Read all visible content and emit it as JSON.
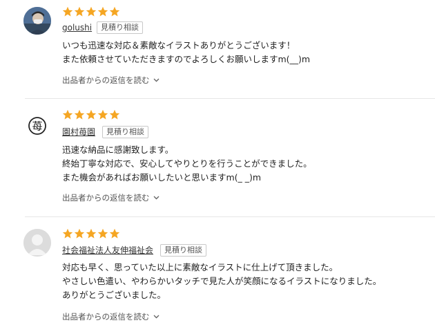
{
  "colors": {
    "star": "#f5a623",
    "divider": "#e6e6e6",
    "text": "#222222"
  },
  "reviews": [
    {
      "rating": 5,
      "avatar": "photo-avatar",
      "reviewer": "golushi",
      "tag": "見積り相談",
      "lines": [
        "いつも迅速な対応＆素敵なイラストありがとうございます！",
        "また依頼させていただきますのでよろしくお願いしますm(__)m"
      ],
      "reply_toggle": "出品者からの返信を読む"
    },
    {
      "rating": 5,
      "avatar": "kanji-avatar",
      "avatar_text": "苺",
      "reviewer": "園村苺園",
      "tag": "見積り相談",
      "lines": [
        "迅速な納品に感謝致します。",
        "終始丁寧な対応で、安心してやりとりを行うことができました。",
        "また機会があればお願いしたいと思いますm(_ _)m"
      ],
      "reply_toggle": "出品者からの返信を読む"
    },
    {
      "rating": 5,
      "avatar": "default-user-avatar",
      "reviewer": "社会福祉法人友伸福祉会",
      "tag": "見積り相談",
      "lines": [
        "対応も早く、思っていた以上に素敵なイラストに仕上げて頂きました。",
        "やさしい色遣い、やわらかいタッチで見た人が笑顔になるイラストになりました。",
        "ありがとうございました。"
      ],
      "reply_toggle": "出品者からの返信を読む"
    }
  ]
}
